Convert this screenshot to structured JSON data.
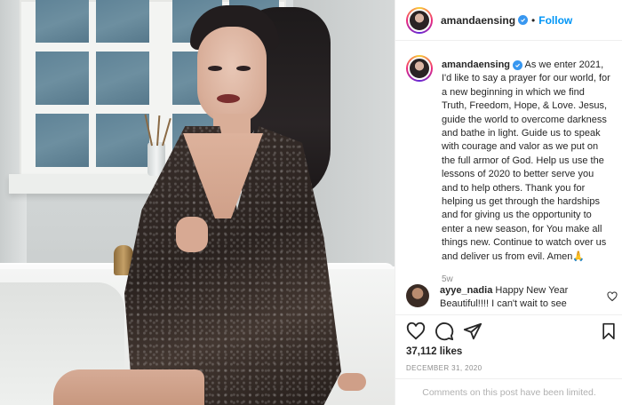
{
  "post": {
    "username": "amandaensing",
    "dot": "•",
    "follow_label": "Follow",
    "caption": "As we enter 2021, I'd like to say a prayer for our world, for a new beginning in which we find Truth, Freedom, Hope, & Love. Jesus, guide the world to overcome darkness and bathe in light. Guide us to speak with courage and valor as we put on the full armor of God. Help us use the lessons of 2020 to better serve you and to help others. Thank you for helping us get through the hardships and for giving us the opportunity to enter a new season, for You make all things new. Continue to watch over us and deliver us from evil. Amen🙏",
    "time_ago": "5w",
    "likes": "37,112 likes",
    "date": "DECEMBER 31, 2020",
    "comments_limited": "Comments on this post have been limited."
  },
  "comment": {
    "username": "ayye_nadia",
    "text": "Happy New Year Beautiful!!!! I can't wait to see"
  },
  "icons": {
    "verified": "verified-badge-icon",
    "like": "heart-icon",
    "comment": "comment-icon",
    "share": "share-icon",
    "save": "bookmark-icon",
    "comment_like": "small-heart-icon"
  },
  "colors": {
    "link_blue": "#0095f6",
    "verified_blue": "#3897f0",
    "text": "#262626",
    "muted": "#8e8e8e"
  }
}
